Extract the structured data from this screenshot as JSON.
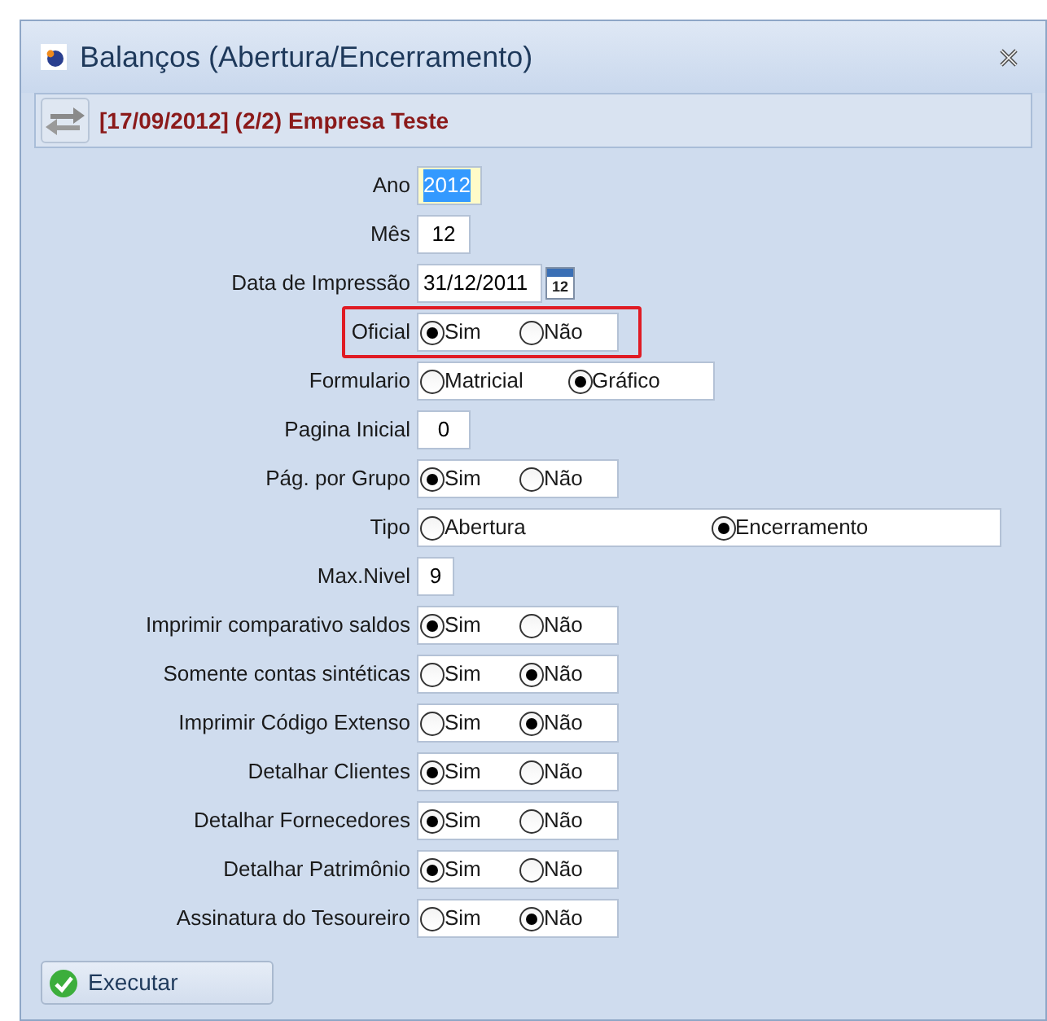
{
  "window": {
    "title": "Balanços (Abertura/Encerramento)"
  },
  "header": {
    "text": "[17/09/2012] (2/2) Empresa Teste"
  },
  "fields": [
    {
      "kind": "text",
      "label": "Ano",
      "value": "2012",
      "focused": true
    },
    {
      "kind": "text",
      "label": "Mês",
      "value": "12",
      "focused": false
    },
    {
      "kind": "date",
      "label": "Data de Impressão",
      "value": "31/12/2011",
      "calendar_day": "12"
    },
    {
      "kind": "radio",
      "label": "Oficial",
      "highlighted": true,
      "options": [
        {
          "label": "Sim",
          "selected": true
        },
        {
          "label": "Não",
          "selected": false
        }
      ]
    },
    {
      "kind": "radio",
      "label": "Formulario",
      "highlighted": false,
      "options": [
        {
          "label": "Matricial",
          "selected": false
        },
        {
          "label": "Gráfico",
          "selected": true
        }
      ]
    },
    {
      "kind": "text",
      "label": "Pagina Inicial",
      "value": "0",
      "focused": false
    },
    {
      "kind": "radio",
      "label": "Pág. por Grupo",
      "highlighted": false,
      "options": [
        {
          "label": "Sim",
          "selected": true
        },
        {
          "label": "Não",
          "selected": false
        }
      ]
    },
    {
      "kind": "radio",
      "label": "Tipo",
      "highlighted": false,
      "options": [
        {
          "label": "Abertura",
          "selected": false
        },
        {
          "label": "Encerramento",
          "selected": true
        }
      ]
    },
    {
      "kind": "text",
      "label": "Max.Nivel",
      "value": "9",
      "focused": false
    },
    {
      "kind": "radio",
      "label": "Imprimir comparativo saldos",
      "highlighted": false,
      "options": [
        {
          "label": "Sim",
          "selected": true
        },
        {
          "label": "Não",
          "selected": false
        }
      ]
    },
    {
      "kind": "radio",
      "label": "Somente contas sintéticas",
      "highlighted": false,
      "options": [
        {
          "label": "Sim",
          "selected": false
        },
        {
          "label": "Não",
          "selected": true
        }
      ]
    },
    {
      "kind": "radio",
      "label": "Imprimir Código Extenso",
      "highlighted": false,
      "options": [
        {
          "label": "Sim",
          "selected": false
        },
        {
          "label": "Não",
          "selected": true
        }
      ]
    },
    {
      "kind": "radio",
      "label": "Detalhar Clientes",
      "highlighted": false,
      "options": [
        {
          "label": "Sim",
          "selected": true
        },
        {
          "label": "Não",
          "selected": false
        }
      ]
    },
    {
      "kind": "radio",
      "label": "Detalhar Fornecedores",
      "highlighted": false,
      "options": [
        {
          "label": "Sim",
          "selected": true
        },
        {
          "label": "Não",
          "selected": false
        }
      ]
    },
    {
      "kind": "radio",
      "label": "Detalhar Patrimônio",
      "highlighted": false,
      "options": [
        {
          "label": "Sim",
          "selected": true
        },
        {
          "label": "Não",
          "selected": false
        }
      ]
    },
    {
      "kind": "radio",
      "label": "Assinatura do Tesoureiro",
      "highlighted": false,
      "options": [
        {
          "label": "Sim",
          "selected": false
        },
        {
          "label": "Não",
          "selected": true
        }
      ]
    }
  ],
  "buttons": [
    {
      "label": "Executar"
    }
  ]
}
